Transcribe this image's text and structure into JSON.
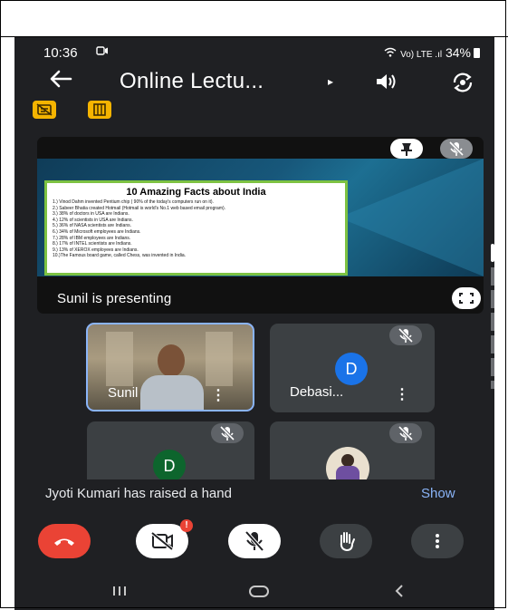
{
  "status_bar": {
    "time": "10:36",
    "network": "Vo) LTE .ıl",
    "battery": "34%"
  },
  "app_bar": {
    "title": "Online Lectu...",
    "caret": "▸"
  },
  "presentation": {
    "slide_title": "10 Amazing Facts about India",
    "facts": [
      "1.) Vinod Dahm invented Pentium chip ( 90% of the today's computers run on it).",
      "2.) Sabeer Bhatia created Hotmail (Hotmail is world's No.1 web based email program).",
      "3.) 38% of doctors in USA are Indians.",
      "4.) 12% of scientists in USA are Indians.",
      "5.) 36% of NASA scientists are Indians.",
      "6.) 34% of Microsoft employees are Indians.",
      "7.) 28% of IBM employees are Indians.",
      "8.) 17% of INTEL scientists are Indians.",
      "9.) 13% of XEROX employees are Indians.",
      "10.)The Famous board game, called Chess, was invented in India."
    ],
    "presenter_label": "Sunil is presenting"
  },
  "participants": [
    {
      "name": "Sunil",
      "avatar": ""
    },
    {
      "name": "Debasi...",
      "avatar": "D"
    },
    {
      "name": "",
      "avatar": "D"
    },
    {
      "name": "",
      "avatar": ""
    }
  ],
  "toast": {
    "message": "Jyoti Kumari has raised a hand",
    "action": "Show"
  },
  "colors": {
    "background": "#1f2023",
    "tile": "#3c4043",
    "hangup": "#ea4335",
    "avatar_blue": "#1a73e8",
    "avatar_green": "#0d652d",
    "chip": "#f5b400",
    "action": "#8ab4f8"
  },
  "icons": [
    "back-arrow-icon",
    "speaker-icon",
    "switch-camera-icon",
    "pin-icon",
    "mic-off-icon",
    "fullscreen-icon",
    "hang-up-icon",
    "camera-off-icon",
    "raise-hand-icon",
    "more-vert-icon"
  ]
}
